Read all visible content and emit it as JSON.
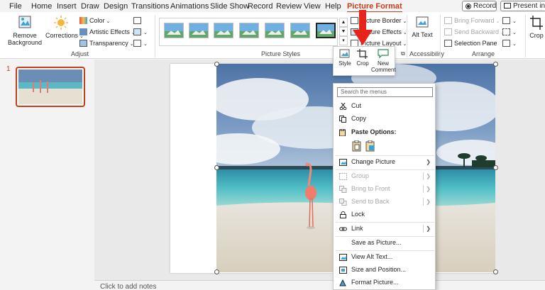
{
  "menubar": {
    "tabs": [
      "File",
      "Home",
      "Insert",
      "Draw",
      "Design",
      "Transitions",
      "Animations",
      "Slide Show",
      "Record",
      "Review",
      "View",
      "Help",
      "Picture Format"
    ],
    "active_tab": "Picture Format",
    "record_label": "Record",
    "present_label": "Present in Te"
  },
  "ribbon": {
    "adjust": {
      "remove_bg": "Remove Background",
      "corrections": "Corrections",
      "color": "Color",
      "artistic": "Artistic Effects",
      "transparency": "Transparency",
      "group_label": "Adjust"
    },
    "styles": {
      "group_label": "Picture Styles"
    },
    "picture_border": "Picture Border",
    "picture_effects": "Picture Effects",
    "picture_layout": "Picture Layout",
    "accessibility": {
      "alt_text": "Alt Text",
      "group_label": "Accessibility"
    },
    "arrange": {
      "bring_forward": "Bring Forward",
      "send_backward": "Send Backward",
      "selection_pane": "Selection Pane",
      "group_label": "Arrange"
    },
    "size": {
      "crop": "Crop"
    }
  },
  "mini_toolbar": {
    "style": "Style",
    "crop": "Crop",
    "new_comment": "New Comment"
  },
  "thumbnails": {
    "slide_number": "1"
  },
  "notes": {
    "placeholder": "Click to add notes"
  },
  "context_menu": {
    "search_placeholder": "Search the menus",
    "items": {
      "cut": "Cut",
      "copy": "Copy",
      "paste_options": "Paste Options:",
      "change_picture": "Change Picture",
      "group": "Group",
      "bring_to_front": "Bring to Front",
      "send_to_back": "Send to Back",
      "lock": "Lock",
      "link": "Link",
      "save_as_picture": "Save as Picture...",
      "view_alt_text": "View Alt Text...",
      "size_and_position": "Size and Position...",
      "format_picture": "Format Picture..."
    }
  },
  "colors": {
    "accent": "#c43e1c",
    "arrow": "#e8231a"
  }
}
